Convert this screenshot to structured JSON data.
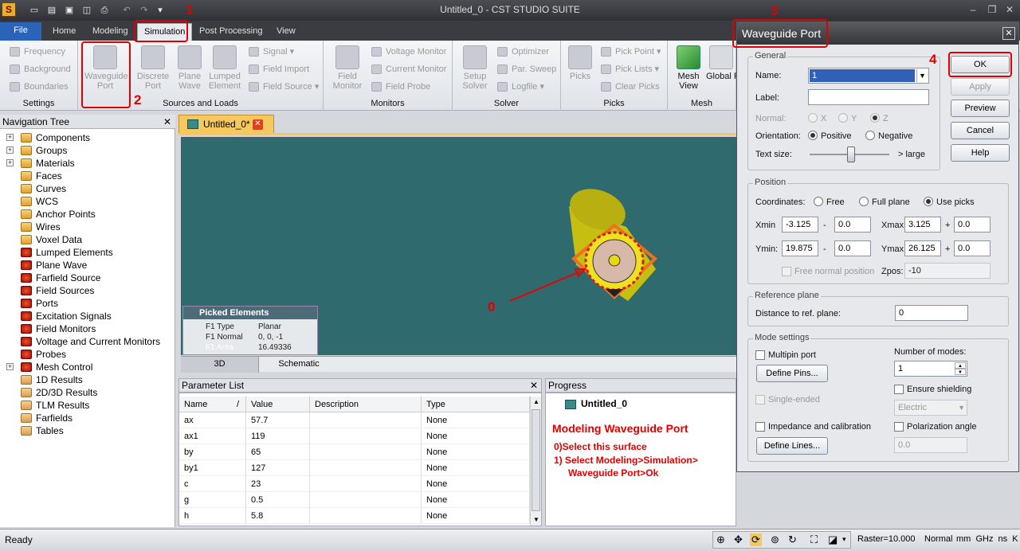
{
  "window": {
    "title": "Untitled_0 - CST STUDIO SUITE"
  },
  "tabs": [
    "File",
    "Home",
    "Modeling",
    "Simulation",
    "Post Processing",
    "View"
  ],
  "ribbon": {
    "settings": {
      "label": "Settings",
      "items": [
        "Frequency",
        "Background",
        "Boundaries"
      ]
    },
    "sources": {
      "label": "Sources and Loads",
      "big": [
        "Waveguide Port",
        "Discrete Port",
        "Plane Wave",
        "Lumped Element"
      ],
      "small": [
        "Signal",
        "Field Import",
        "Field Source"
      ]
    },
    "monitors": {
      "label": "Monitors",
      "big": "Field Monitor",
      "small": [
        "Voltage Monitor",
        "Current Monitor",
        "Field Probe"
      ]
    },
    "solver": {
      "label": "Solver",
      "big": "Setup Solver",
      "small": [
        "Optimizer",
        "Par. Sweep",
        "Logfile"
      ]
    },
    "picks": {
      "label": "Picks",
      "big": "Picks",
      "small": [
        "Pick Point",
        "Pick Lists",
        "Clear Picks"
      ]
    },
    "mesh": {
      "label": "Mesh",
      "big": "Mesh View",
      "big2": "Global Properties"
    }
  },
  "nav": {
    "title": "Navigation Tree",
    "items": [
      {
        "label": "Components",
        "plus": true,
        "kind": "fold"
      },
      {
        "label": "Groups",
        "plus": true,
        "kind": "fold"
      },
      {
        "label": "Materials",
        "plus": true,
        "kind": "fold"
      },
      {
        "label": "Faces",
        "kind": "fold"
      },
      {
        "label": "Curves",
        "kind": "fold"
      },
      {
        "label": "WCS",
        "kind": "fold"
      },
      {
        "label": "Anchor Points",
        "kind": "fold"
      },
      {
        "label": "Wires",
        "kind": "fold"
      },
      {
        "label": "Voxel Data",
        "kind": "fold"
      },
      {
        "label": "Lumped Elements",
        "kind": "red"
      },
      {
        "label": "Plane Wave",
        "kind": "red"
      },
      {
        "label": "Farfield Source",
        "kind": "red"
      },
      {
        "label": "Field Sources",
        "kind": "red"
      },
      {
        "label": "Ports",
        "kind": "red"
      },
      {
        "label": "Excitation Signals",
        "kind": "red"
      },
      {
        "label": "Field Monitors",
        "kind": "red"
      },
      {
        "label": "Voltage and Current Monitors",
        "kind": "red"
      },
      {
        "label": "Probes",
        "kind": "red"
      },
      {
        "label": "Mesh Control",
        "plus": true,
        "kind": "red"
      },
      {
        "label": "1D Results",
        "kind": "res"
      },
      {
        "label": "2D/3D Results",
        "kind": "res"
      },
      {
        "label": "TLM Results",
        "kind": "res"
      },
      {
        "label": "Farfields",
        "kind": "res"
      },
      {
        "label": "Tables",
        "kind": "res"
      }
    ]
  },
  "doc": {
    "tab": "Untitled_0*",
    "view_tabs": [
      "3D",
      "Schematic"
    ]
  },
  "picked": {
    "title": "Picked Elements",
    "rows": [
      [
        "F1 Type",
        "Planar"
      ],
      [
        "F1 Normal",
        "0, 0, -1"
      ],
      [
        "F1 Area",
        "16.49336"
      ]
    ]
  },
  "annotations": {
    "n0": "0",
    "n1": "1",
    "n2": "2",
    "n3": "3",
    "n4": "4"
  },
  "params": {
    "title": "Parameter List",
    "headers": [
      "Name",
      "/",
      "Value",
      "Description",
      "Type"
    ],
    "rows": [
      [
        "ax",
        "57.7",
        "None"
      ],
      [
        "ax1",
        "119",
        "None"
      ],
      [
        "by",
        "65",
        "None"
      ],
      [
        "by1",
        "127",
        "None"
      ],
      [
        "c",
        "23",
        "None"
      ],
      [
        "g",
        "0.5",
        "None"
      ],
      [
        "h",
        "5.8",
        "None"
      ]
    ]
  },
  "progress": {
    "title": "Progress",
    "item": "Untitled_0",
    "heading": "Modeling Waveguide Port",
    "step0": "0)Select this surface",
    "step1": "1) Select Modeling>Simulation>",
    "step1b": "Waveguide Port>Ok"
  },
  "status": {
    "left": "Ready",
    "raster": "Raster=10.000",
    "mode": "Normal",
    "units": "mm  GHz  ns  K"
  },
  "dialog": {
    "title": "Waveguide Port",
    "general": "General",
    "name_label": "Name:",
    "name_value": "1",
    "label_label": "Label:",
    "label_value": "",
    "normal_label": "Normal:",
    "normal_opts": [
      "X",
      "Y",
      "Z"
    ],
    "orientation_label": "Orientation:",
    "orient_opts": [
      "Positive",
      "Negative"
    ],
    "textsize_label": "Text size:",
    "textsize_right": "> large",
    "buttons": [
      "OK",
      "Apply",
      "Preview",
      "Cancel",
      "Help"
    ],
    "position": "Position",
    "coords_label": "Coordinates:",
    "coord_opts": [
      "Free",
      "Full plane",
      "Use picks"
    ],
    "xmin_label": "Xmin",
    "xmin": "-3.125",
    "xmin_off": "0.0",
    "xmax_label": "Xmax",
    "xmax": "3.125",
    "xmax_off": "0.0",
    "ymin_label": "Ymin:",
    "ymin": "19.875",
    "ymin_off": "0.0",
    "ymax_label": "Ymax:",
    "ymax": "26.125",
    "ymax_off": "0.0",
    "minus": "-",
    "plus": "+",
    "free_normal": "Free normal position",
    "zpos_label": "Zpos:",
    "zpos": "-10",
    "refplane": "Reference plane",
    "dist_label": "Distance to ref. plane:",
    "dist": "0",
    "mode": "Mode settings",
    "multipin": "Multipin port",
    "define_pins": "Define Pins...",
    "num_modes_label": "Number of modes:",
    "num_modes": "1",
    "single_ended": "Single-ended",
    "ensure_shielding": "Ensure shielding",
    "shielding_value": "Electric",
    "impedance": "Impedance and calibration",
    "define_lines": "Define Lines...",
    "polarization": "Polarization angle",
    "polarization_value": "0.0"
  }
}
